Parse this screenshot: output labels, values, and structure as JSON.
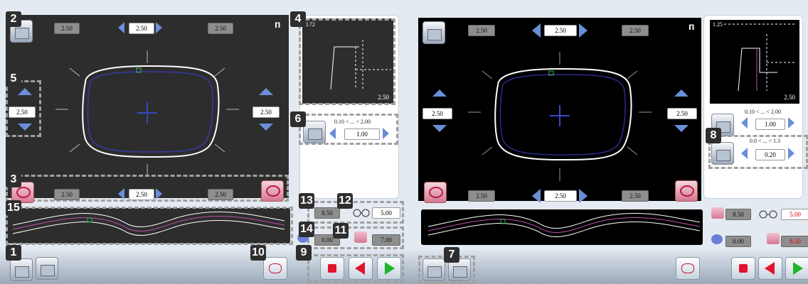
{
  "screenshot": {
    "left": {
      "top": {
        "left": "2.50",
        "center": "2.50",
        "right": "2.50"
      },
      "bottom": {
        "left": "2.50",
        "center": "2.50",
        "right": "2.50"
      },
      "side": {
        "left": "2.50",
        "right": "2.50"
      },
      "preview": {
        "top_value": "0.72",
        "bottom_value": "2.50"
      },
      "range_label": "0.10 < ... < 2.00",
      "range_value": "1.00",
      "params": {
        "p1": "8.50",
        "p2": "5.00",
        "p3": "0.00",
        "p4": "7.00"
      },
      "callouts": [
        "1",
        "2",
        "3",
        "4",
        "5",
        "6",
        "9",
        "10",
        "11",
        "12",
        "13",
        "14",
        "15"
      ],
      "corner_glyph": "ᴨ"
    },
    "right": {
      "top": {
        "left": "2.50",
        "center": "2.50",
        "right": "2.50"
      },
      "bottom": {
        "left": "2.50",
        "center": "2.50",
        "right": "2.50"
      },
      "side": {
        "left": "2.50",
        "right": "2.50"
      },
      "preview": {
        "top_value": "1.25",
        "bottom_value": "2.50"
      },
      "range1_label": "0.10 < ... < 2.00",
      "range1_value": "1.00",
      "range2_label": "0.0 < ... < 1.3",
      "range2_value": "0.20",
      "params": {
        "p1": "8.50",
        "p2": "5.00",
        "p3": "0.00",
        "p4": "8.50"
      },
      "callouts": [
        "7",
        "8"
      ],
      "corner_glyph": "ᴨ"
    },
    "colors": {
      "arrow": "#6a8fd8",
      "red": "#e0142c",
      "green": "#1fb52a",
      "callout_bg": "#2e2e2e"
    },
    "icons": [
      "edit-icon",
      "shape-icon",
      "stop-icon",
      "back-icon",
      "play-icon",
      "glasses-icon",
      "frame-icon"
    ]
  }
}
